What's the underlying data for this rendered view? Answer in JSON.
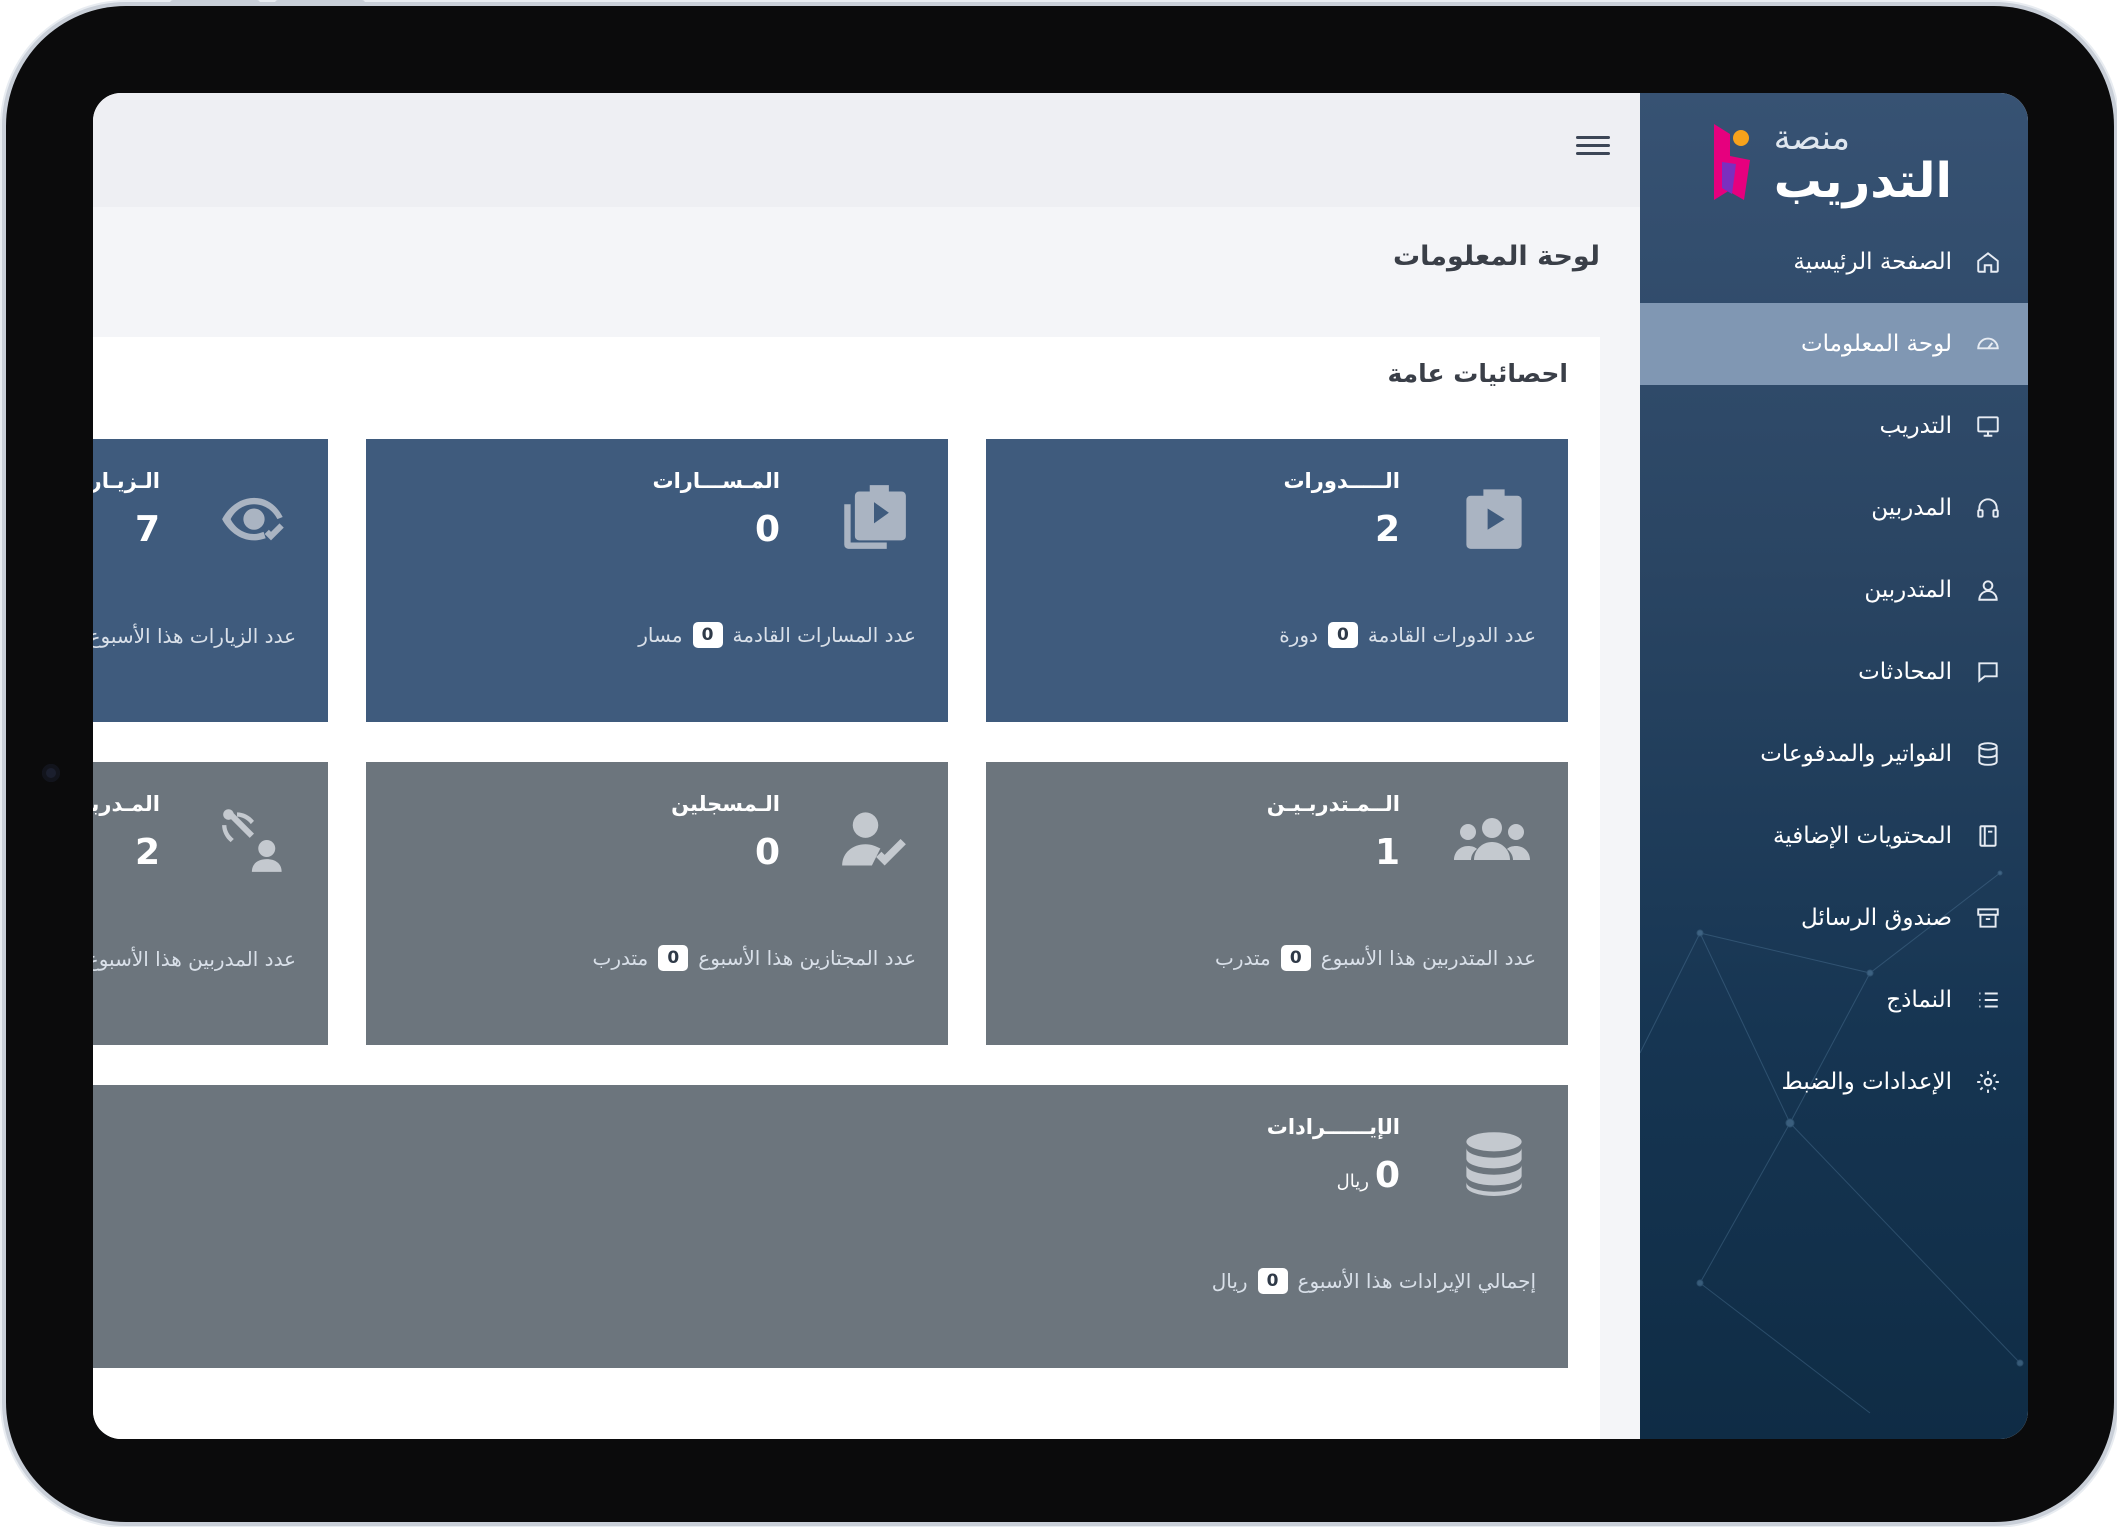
{
  "brand": {
    "line1": "منصة",
    "line2": "التدريب"
  },
  "sidebar": {
    "items": [
      {
        "label": "الصفحة الرئيسية",
        "icon": "home-icon",
        "active": false
      },
      {
        "label": "لوحة المعلومات",
        "icon": "dashboard-icon",
        "active": true
      },
      {
        "label": "التدريب",
        "icon": "monitor-icon",
        "active": false
      },
      {
        "label": "المدربين",
        "icon": "headset-icon",
        "active": false
      },
      {
        "label": "المتدربين",
        "icon": "user-icon",
        "active": false
      },
      {
        "label": "المحادثات",
        "icon": "chat-icon",
        "active": false
      },
      {
        "label": "الفواتير والمدفوعات",
        "icon": "database-icon",
        "active": false
      },
      {
        "label": "المحتويات الإضافية",
        "icon": "notebook-icon",
        "active": false
      },
      {
        "label": "صندوق الرسائل",
        "icon": "archive-icon",
        "active": false
      },
      {
        "label": "النماذج",
        "icon": "list-icon",
        "active": false
      },
      {
        "label": "الإعدادات والضبط",
        "icon": "gear-icon",
        "active": false
      }
    ]
  },
  "page": {
    "title": "لوحة المعلومات",
    "section_title": "احصائيات عامة"
  },
  "cards": {
    "courses": {
      "title": "الـــــدورات",
      "value": "2",
      "foot_pre": "عدد الدورات القادمة",
      "badge": "0",
      "foot_post": "دورة"
    },
    "tracks": {
      "title": "المـســـارات",
      "value": "0",
      "foot_pre": "عدد المسارات القادمة",
      "badge": "0",
      "foot_post": "مسار"
    },
    "visits": {
      "title": "الـزيـارات",
      "value": "7",
      "foot_pre": "عدد الزيارات هذا الأسبوع"
    },
    "trainees": {
      "title": "الــمـتدربـيـن",
      "value": "1",
      "foot_pre": "عدد المتدربين هذا الأسبوع",
      "badge": "0",
      "foot_post": "متدرب"
    },
    "registered": {
      "title": "الـمسجلين",
      "value": "0",
      "foot_pre": "عدد المجتازين هذا الأسبوع",
      "badge": "0",
      "foot_post": "متدرب"
    },
    "trainers": {
      "title": "المـدربين",
      "value": "2",
      "foot_pre": "عدد المدربين هذا الأسبوع"
    },
    "revenue": {
      "title": "الإيــــــرادات",
      "value": "0",
      "unit": "ريال",
      "foot_pre": "إجمالي الإيرادات هذا الأسبوع",
      "badge": "0",
      "foot_post": "ريال"
    }
  },
  "colors": {
    "sidebar": "#2a4563",
    "sidebar_active": "#8097b3",
    "card_blue": "#3f5b7d",
    "card_gray": "#6c757d",
    "logo_pink": "#e6007e",
    "logo_purple": "#7b2fbf",
    "logo_orange": "#f7a21b"
  }
}
